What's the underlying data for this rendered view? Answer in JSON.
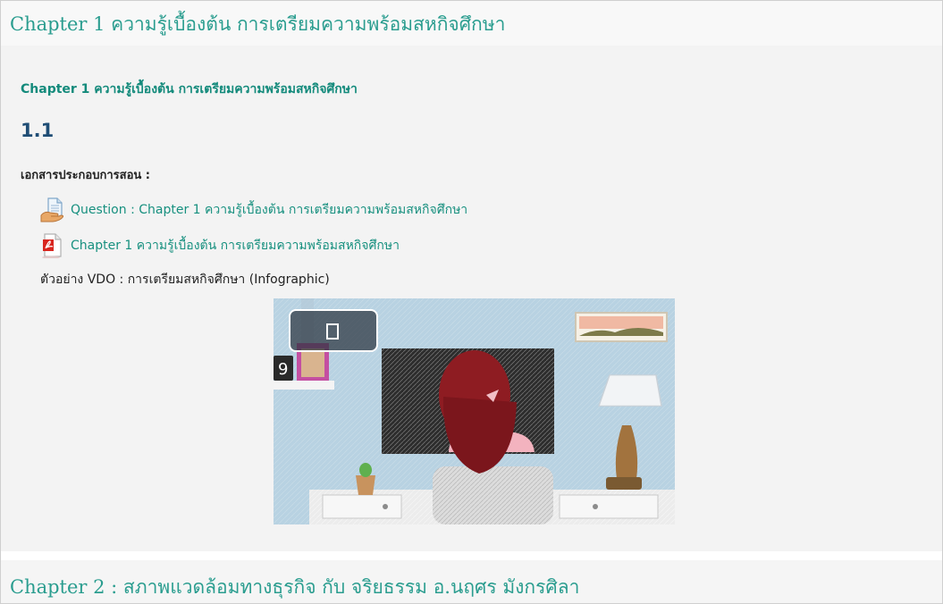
{
  "section1": {
    "title": "Chapter 1 ความรู้เบื้องต้น การเตรียมความพร้อมสหกิจศึกษา",
    "summary_title": "Chapter 1 ความรู้เบื้องต้น การเตรียมความพร้อมสหกิจศึกษา",
    "lesson_number": "1.1",
    "docs_label": "เอกสารประกอบการสอน :",
    "activities": [
      {
        "icon": "quiz-icon",
        "label": "Question : Chapter 1 ความรู้เบื้องต้น การเตรียมความพร้อมสหกิจศึกษา"
      },
      {
        "icon": "pdf-icon",
        "label": "Chapter 1 ความรู้เบื้องต้น การเตรียมความพร้อมสหกิจศึกษา"
      }
    ],
    "video_label": "ตัวอย่าง VDO : การเตรียมสหกิจศึกษา (Infographic)",
    "video": {
      "play_icon": "play-icon",
      "clock_digit": "9"
    }
  },
  "section2": {
    "title": "Chapter 2 : สภาพแวดล้อมทางธุรกิจ กับ จริยธรรม อ.นฤศร มังกรศิลา"
  },
  "colors": {
    "section_title": "#2a9d8f",
    "link": "#17907f",
    "lesson_number": "#1f4d75"
  }
}
